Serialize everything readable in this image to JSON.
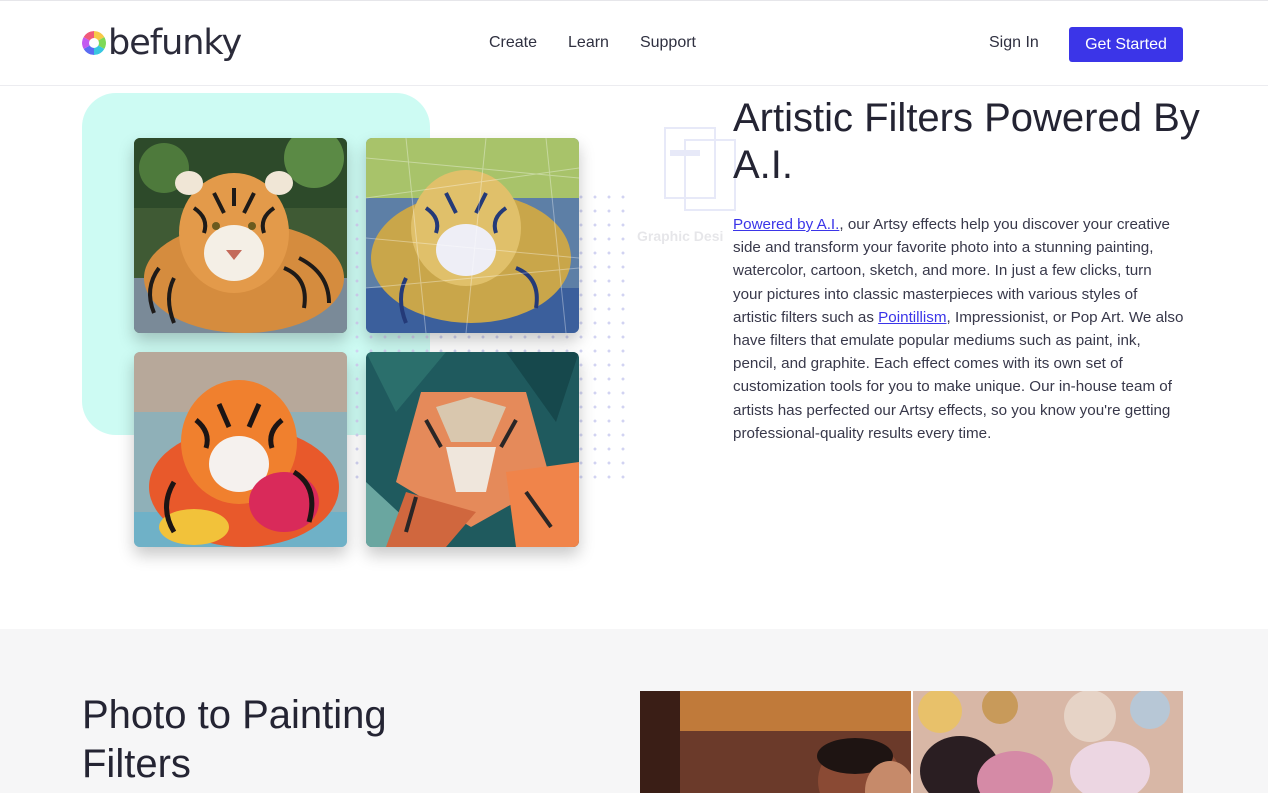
{
  "brand": {
    "logo_text": "befunky",
    "accent_color": "#3b35e8",
    "mint_color": "#cdfbf3"
  },
  "nav": {
    "items": [
      {
        "label": "Create"
      },
      {
        "label": "Learn"
      },
      {
        "label": "Support"
      }
    ],
    "sign_in": "Sign In",
    "get_started": "Get Started"
  },
  "hero": {
    "title": "Artistic Filters Powered By A.I.",
    "body": {
      "link1": "Powered by A.I.",
      "text1": ", our Artsy effects help you discover your creative side and transform your favorite photo into a stunning painting, watercolor, cartoon, sketch, and more. In just a few clicks, turn your pictures into classic masterpieces with various styles of artistic filters such as ",
      "link2": "Pointillism",
      "text2": ", Impressionist, or Pop Art. We also have filters that emulate popular mediums such as paint, ink, pencil, and graphite. Each effect comes with its own set of customization tools for you to make unique. Our in-house team of artists has perfected our Artsy effects, so you know you're getting professional-quality results every time."
    },
    "images": [
      {
        "name": "tiger-original",
        "icon": "tiger-photo"
      },
      {
        "name": "tiger-mosaic",
        "icon": "tiger-mosaic-filter"
      },
      {
        "name": "tiger-painting",
        "icon": "tiger-painting-filter"
      },
      {
        "name": "tiger-lowpoly",
        "icon": "tiger-lowpoly-filter"
      }
    ],
    "ghost_title": "Graphic Desi"
  },
  "section2": {
    "title": "Photo to Painting Filters"
  }
}
